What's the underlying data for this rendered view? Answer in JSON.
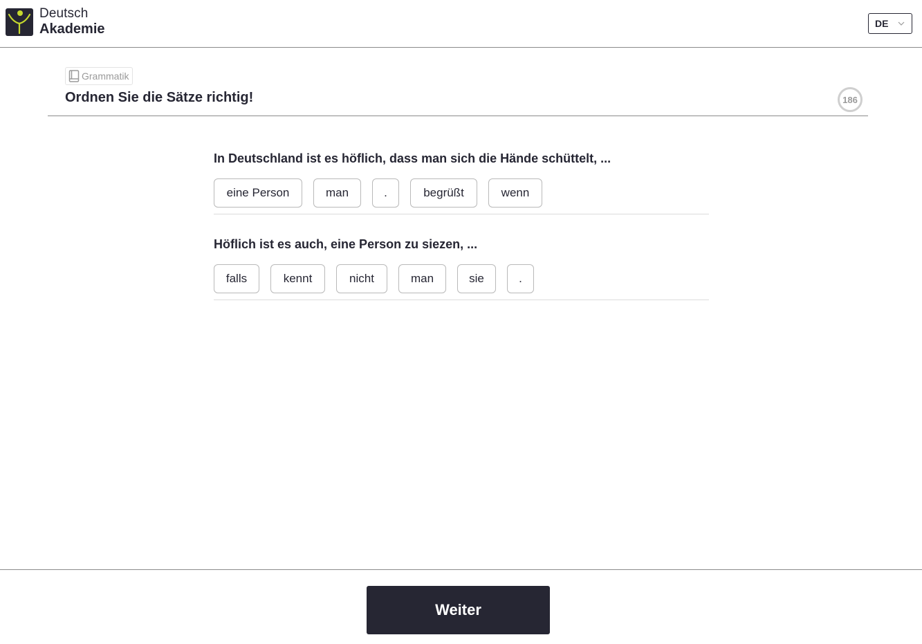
{
  "header": {
    "logo": {
      "line1": "Deutsch",
      "line2": "Akademie"
    },
    "language": {
      "selected": "DE"
    }
  },
  "lesson": {
    "category": "Grammatik",
    "title": "Ordnen Sie die Sätze richtig!",
    "counter": "186"
  },
  "exercises": [
    {
      "prompt": "In Deutschland ist es höflich, dass man sich die Hände schüttelt, ...",
      "words": [
        "eine Person",
        "man",
        ".",
        "begrüßt",
        "wenn"
      ]
    },
    {
      "prompt": "Höflich ist es auch, eine Person zu siezen, ...",
      "words": [
        "falls",
        "kennt",
        "nicht",
        "man",
        "sie",
        "."
      ]
    }
  ],
  "footer": {
    "next_label": "Weiter"
  },
  "colors": {
    "dark": "#262633",
    "brand_green": "#c6d92e",
    "muted": "#9a9a9a"
  }
}
